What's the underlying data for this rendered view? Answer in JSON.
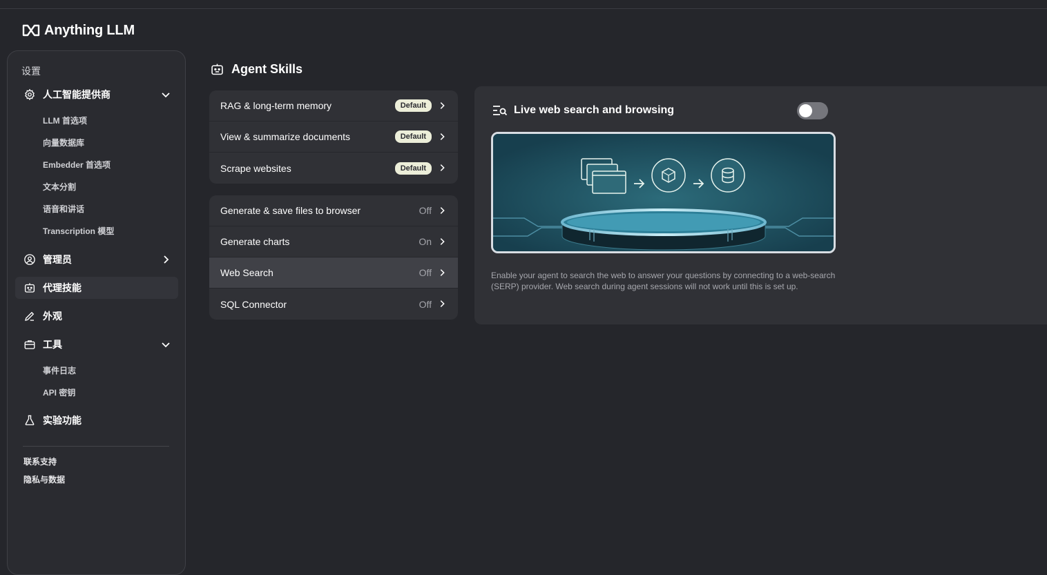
{
  "app": {
    "name": "Anything LLM"
  },
  "sidebar": {
    "title": "设置",
    "items": [
      {
        "label": "人工智能提供商",
        "icon": "gear-icon",
        "expanded": true,
        "children": [
          "LLM 首选项",
          "向量数据库",
          "Embedder 首选项",
          "文本分割",
          "语音和讲话",
          "Transcription 模型"
        ]
      },
      {
        "label": "管理员",
        "icon": "user-gear-icon",
        "expanded": false
      },
      {
        "label": "代理技能",
        "icon": "robot-icon",
        "active": true
      },
      {
        "label": "外观",
        "icon": "pencil-icon"
      },
      {
        "label": "工具",
        "icon": "toolbox-icon",
        "expanded": true,
        "children": [
          "事件日志",
          "API 密钥"
        ]
      },
      {
        "label": "实验功能",
        "icon": "flask-icon"
      }
    ],
    "footer": [
      "联系支持",
      "隐私与数据"
    ]
  },
  "page": {
    "title": "Agent Skills",
    "icon": "robot-icon"
  },
  "skills_default": [
    {
      "label": "RAG & long-term memory",
      "badge": "Default"
    },
    {
      "label": "View & summarize documents",
      "badge": "Default"
    },
    {
      "label": "Scrape websites",
      "badge": "Default"
    }
  ],
  "skills_optional": [
    {
      "label": "Generate & save files to browser",
      "status": "Off"
    },
    {
      "label": "Generate charts",
      "status": "On"
    },
    {
      "label": "Web Search",
      "status": "Off",
      "selected": true
    },
    {
      "label": "SQL Connector",
      "status": "Off"
    }
  ],
  "detail": {
    "title": "Live web search and browsing",
    "icon": "search-list-icon",
    "enabled": false,
    "description": "Enable your agent to search the web to answer your questions by connecting to a web-search (SERP) provider. Web search during agent sessions will not work until this is set up."
  },
  "colors": {
    "bg": "#25262b",
    "panel": "#303136",
    "badge": "#eceed9",
    "illustration": "#1f4d5e"
  }
}
